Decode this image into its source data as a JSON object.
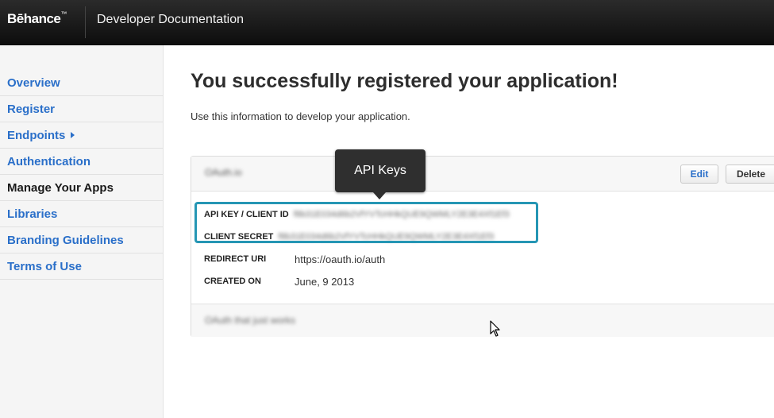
{
  "header": {
    "logo_text": "Bēhance",
    "logo_tm": "™",
    "title": "Developer Documentation"
  },
  "sidebar": {
    "items": [
      {
        "label": "Overview"
      },
      {
        "label": "Register"
      },
      {
        "label": "Endpoints"
      },
      {
        "label": "Authentication"
      },
      {
        "label": "Manage Your Apps"
      },
      {
        "label": "Libraries"
      },
      {
        "label": "Branding Guidelines"
      },
      {
        "label": "Terms of Use"
      }
    ],
    "active": "Manage Your Apps"
  },
  "main": {
    "title": "You successfully registered your application!",
    "subtitle": "Use this information to develop your application."
  },
  "app": {
    "name": "OAuth.io",
    "edit_label": "Edit",
    "delete_label": "Delete",
    "fields": {
      "api_key_label": "API KEY / CLIENT ID",
      "api_key_value": "f8b31E034d6b2VfYVTcHHkQUE9QWMLY2E3E4Xf1Ef3",
      "client_secret_label": "CLIENT SECRET",
      "client_secret_value": "f8b31E034d6b2VfYVTcHHkQUE9QWMLY2E3E4Xf1Ef3",
      "redirect_uri_label": "REDIRECT URI",
      "redirect_uri_value": "https://oauth.io/auth",
      "created_on_label": "CREATED ON",
      "created_on_value": "June, 9 2013"
    },
    "description": "OAuth that just works"
  },
  "tooltip": {
    "label": "API Keys"
  },
  "colors": {
    "link": "#2a6fc9",
    "highlight": "#2596b4",
    "tooltip_bg": "#2f2f2f"
  }
}
